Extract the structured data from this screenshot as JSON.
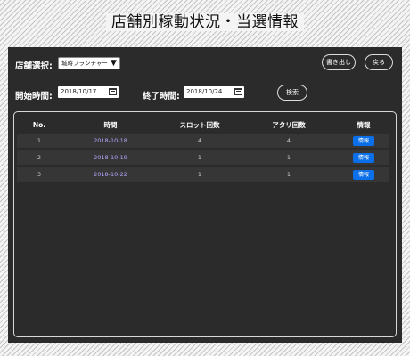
{
  "header": {
    "title": "店舗別稼動状況・当選情報"
  },
  "filters": {
    "store_label": "店舗選択:",
    "store_value": "城時フランチャー",
    "start_label": "開始時間:",
    "start_value": "2018/10/17",
    "end_label": "終了時間:",
    "end_value": "2018/10/24",
    "search_label": "検索"
  },
  "toolbar": {
    "export_label": "書き出し",
    "back_label": "戻る"
  },
  "table": {
    "columns": [
      "No.",
      "時間",
      "スロット回数",
      "アタリ回数",
      "情報"
    ],
    "rows": [
      {
        "no": "1",
        "date": "2018-10-18",
        "slot": "4",
        "hit": "4",
        "info": "情報"
      },
      {
        "no": "2",
        "date": "2018-10-19",
        "slot": "1",
        "hit": "1",
        "info": "情報"
      },
      {
        "no": "3",
        "date": "2018-10-22",
        "slot": "1",
        "hit": "1",
        "info": "情報"
      }
    ]
  },
  "colors": {
    "panel": "#2b2b2b",
    "row": "#363636",
    "date_text": "#b4a7ff",
    "info_button": "#0a6fe8"
  }
}
